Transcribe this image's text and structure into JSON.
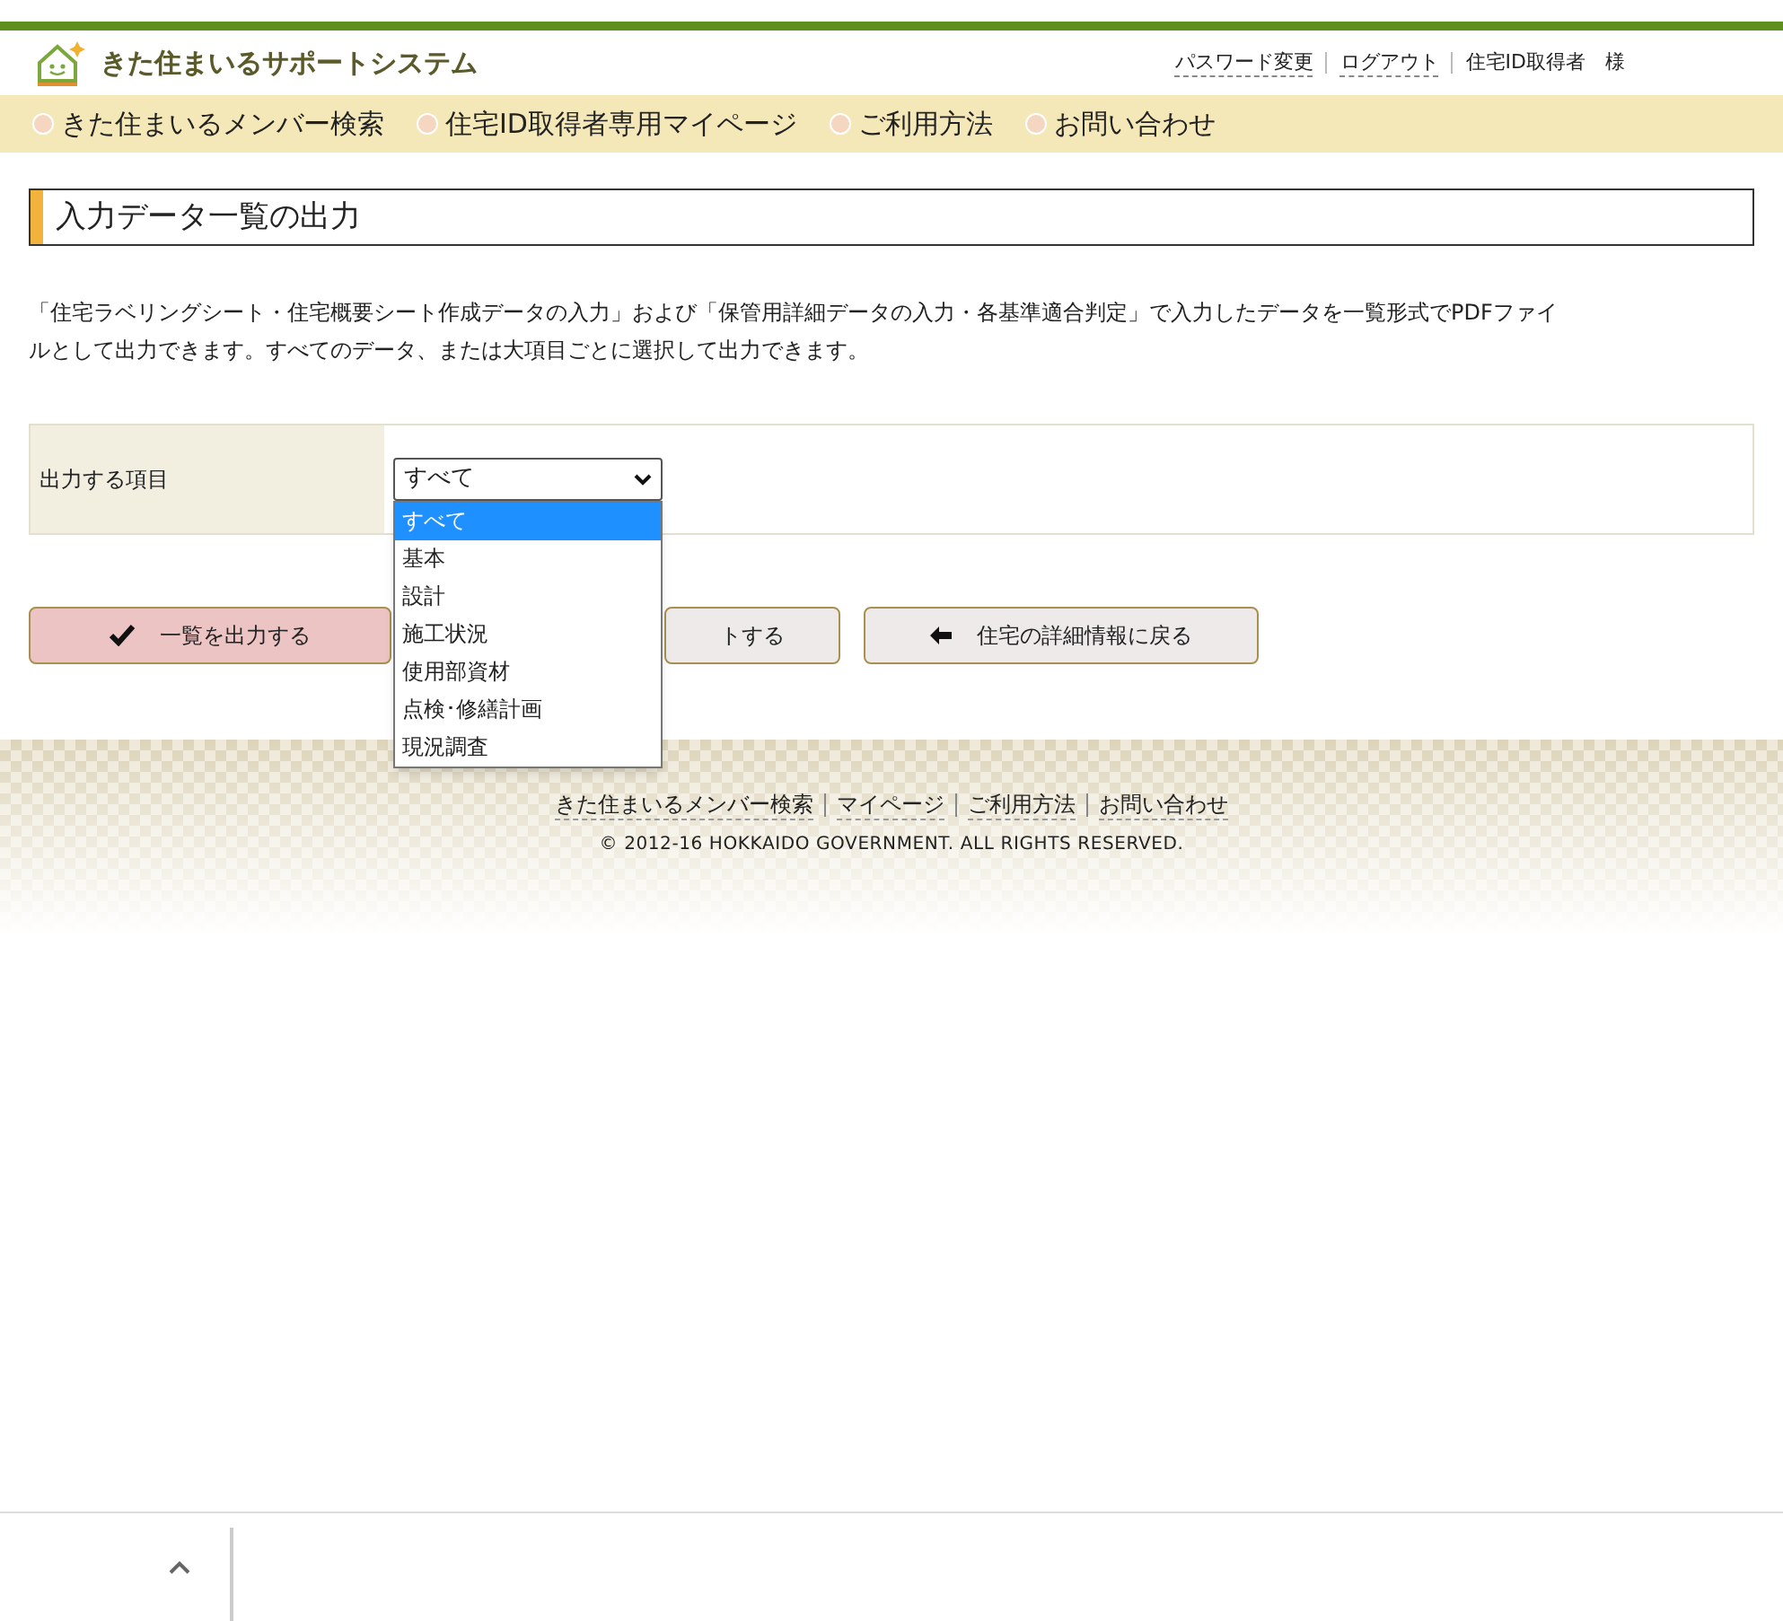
{
  "header": {
    "site_title": "きた住まいるサポートシステム",
    "links": [
      "パスワード変更",
      "ログアウト"
    ],
    "user": "住宅ID取得者　様"
  },
  "nav": [
    "きた住まいるメンバー検索",
    "住宅ID取得者専用マイページ",
    "ご利用方法",
    "お問い合わせ"
  ],
  "page_title": "入力データ一覧の出力",
  "description": [
    "「住宅ラベリングシート・住宅概要シート作成データの入力」および「保管用詳細データの入力・各基準適合判定」で入力したデータを一覧形式でPDFファイ",
    "ルとして出力できます。すべてのデータ、または大項目ごとに選択して出力できます。"
  ],
  "form": {
    "label": "出力する項目",
    "select": {
      "value": "すべて",
      "expanded": true,
      "options": [
        {
          "label": "すべて",
          "selected": true
        },
        {
          "label": "基本",
          "selected": false
        },
        {
          "label": "設計",
          "selected": false
        },
        {
          "label": "施工状況",
          "selected": false
        },
        {
          "label": "使用部資材",
          "selected": false
        },
        {
          "label": "点検･修繕計画",
          "selected": false
        },
        {
          "label": "現況調査",
          "selected": false
        }
      ]
    }
  },
  "buttons": [
    {
      "kind": "primary",
      "label": "一覧を出力する"
    },
    {
      "kind": "secondary",
      "label": "トする"
    },
    {
      "kind": "back",
      "label": "住宅の詳細情報に戻る"
    }
  ],
  "footer": {
    "links": [
      "きた住まいるメンバー検索",
      "マイページ",
      "ご利用方法",
      "お問い合わせ"
    ],
    "copyright": "© 2012-16 HOKKAIDO GOVERNMENT. ALL RIGHTS RESERVED."
  }
}
